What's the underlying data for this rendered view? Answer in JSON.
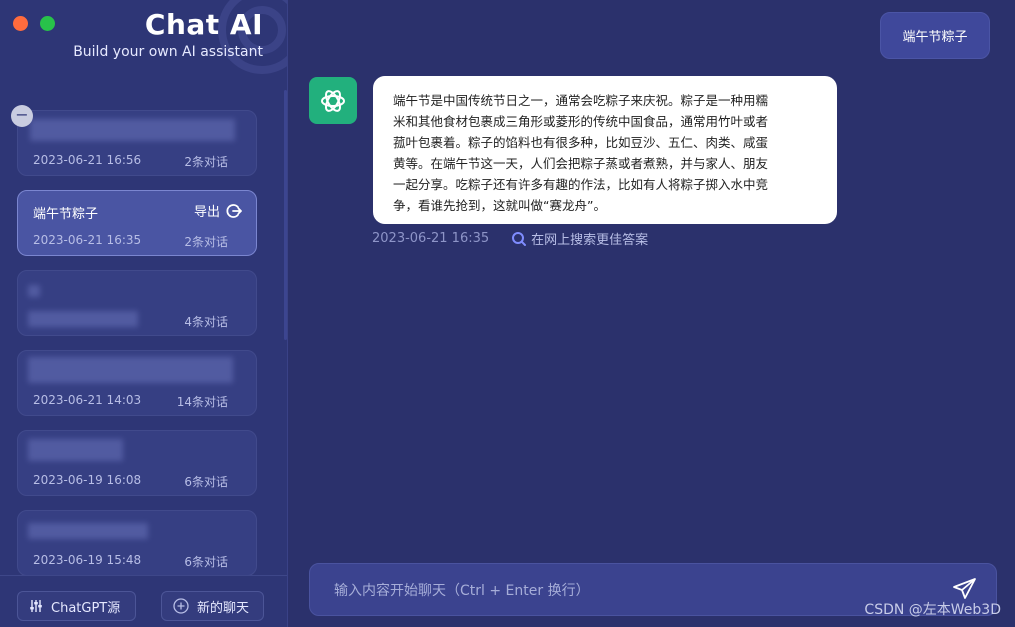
{
  "window": {
    "controls": [
      {
        "name": "close",
        "color": "#ff6b3d"
      },
      {
        "name": "maximize",
        "color": "#28c24a"
      }
    ]
  },
  "brand": {
    "title": "Chat AI",
    "subtitle": "Build your own AI assistant"
  },
  "sessions": [
    {
      "title": "",
      "date": "2023-06-21 16:56",
      "count": "2条对话",
      "active": false
    },
    {
      "title": "端午节粽子",
      "date": "2023-06-21 16:35",
      "count": "2条对话",
      "active": true,
      "export_label": "导出"
    },
    {
      "title": "",
      "date": "2023-06-21 14:47",
      "count": "4条对话",
      "active": false
    },
    {
      "title": "",
      "date": "2023-06-21 14:03",
      "count": "14条对话",
      "active": false
    },
    {
      "title": "",
      "date": "2023-06-19 16:08",
      "count": "6条对话",
      "active": false
    },
    {
      "title": "",
      "date": "2023-06-19 15:48",
      "count": "6条对话",
      "active": false
    }
  ],
  "footer": {
    "source_label": "ChatGPT源",
    "new_chat_label": "新的聊天"
  },
  "chat": {
    "user_message": "端午节粽子",
    "ai_lines": [
      "端午节是中国传统节日之一，通常会吃粽子来庆祝。粽子是一种用糯",
      "米和其他食材包裹成三角形或菱形的传统中国食品，通常用竹叶或者",
      "菰叶包裹着。粽子的馅料也有很多种，比如豆沙、五仁、肉类、咸蛋",
      "黄等。在端午节这一天，人们会把粽子蒸或者煮熟，并与家人、朋友",
      "一起分享。吃粽子还有许多有趣的作法，比如有人将粽子掷入水中竞",
      "争，看谁先抢到，这就叫做“赛龙舟”。"
    ],
    "ai_time": "2023-06-21 16:35",
    "search_label": "在网上搜索更佳答案"
  },
  "input": {
    "placeholder": "输入内容开始聊天（Ctrl + Enter 换行）",
    "value": ""
  },
  "watermark_text": "CSDN @左本Web3D",
  "icons": {
    "delete": "minus-icon",
    "export": "logout-icon",
    "source": "sliders-icon",
    "new_chat": "plus-circle-icon",
    "avatar": "openai-logo-icon",
    "search": "search-icon",
    "send": "send-icon"
  }
}
